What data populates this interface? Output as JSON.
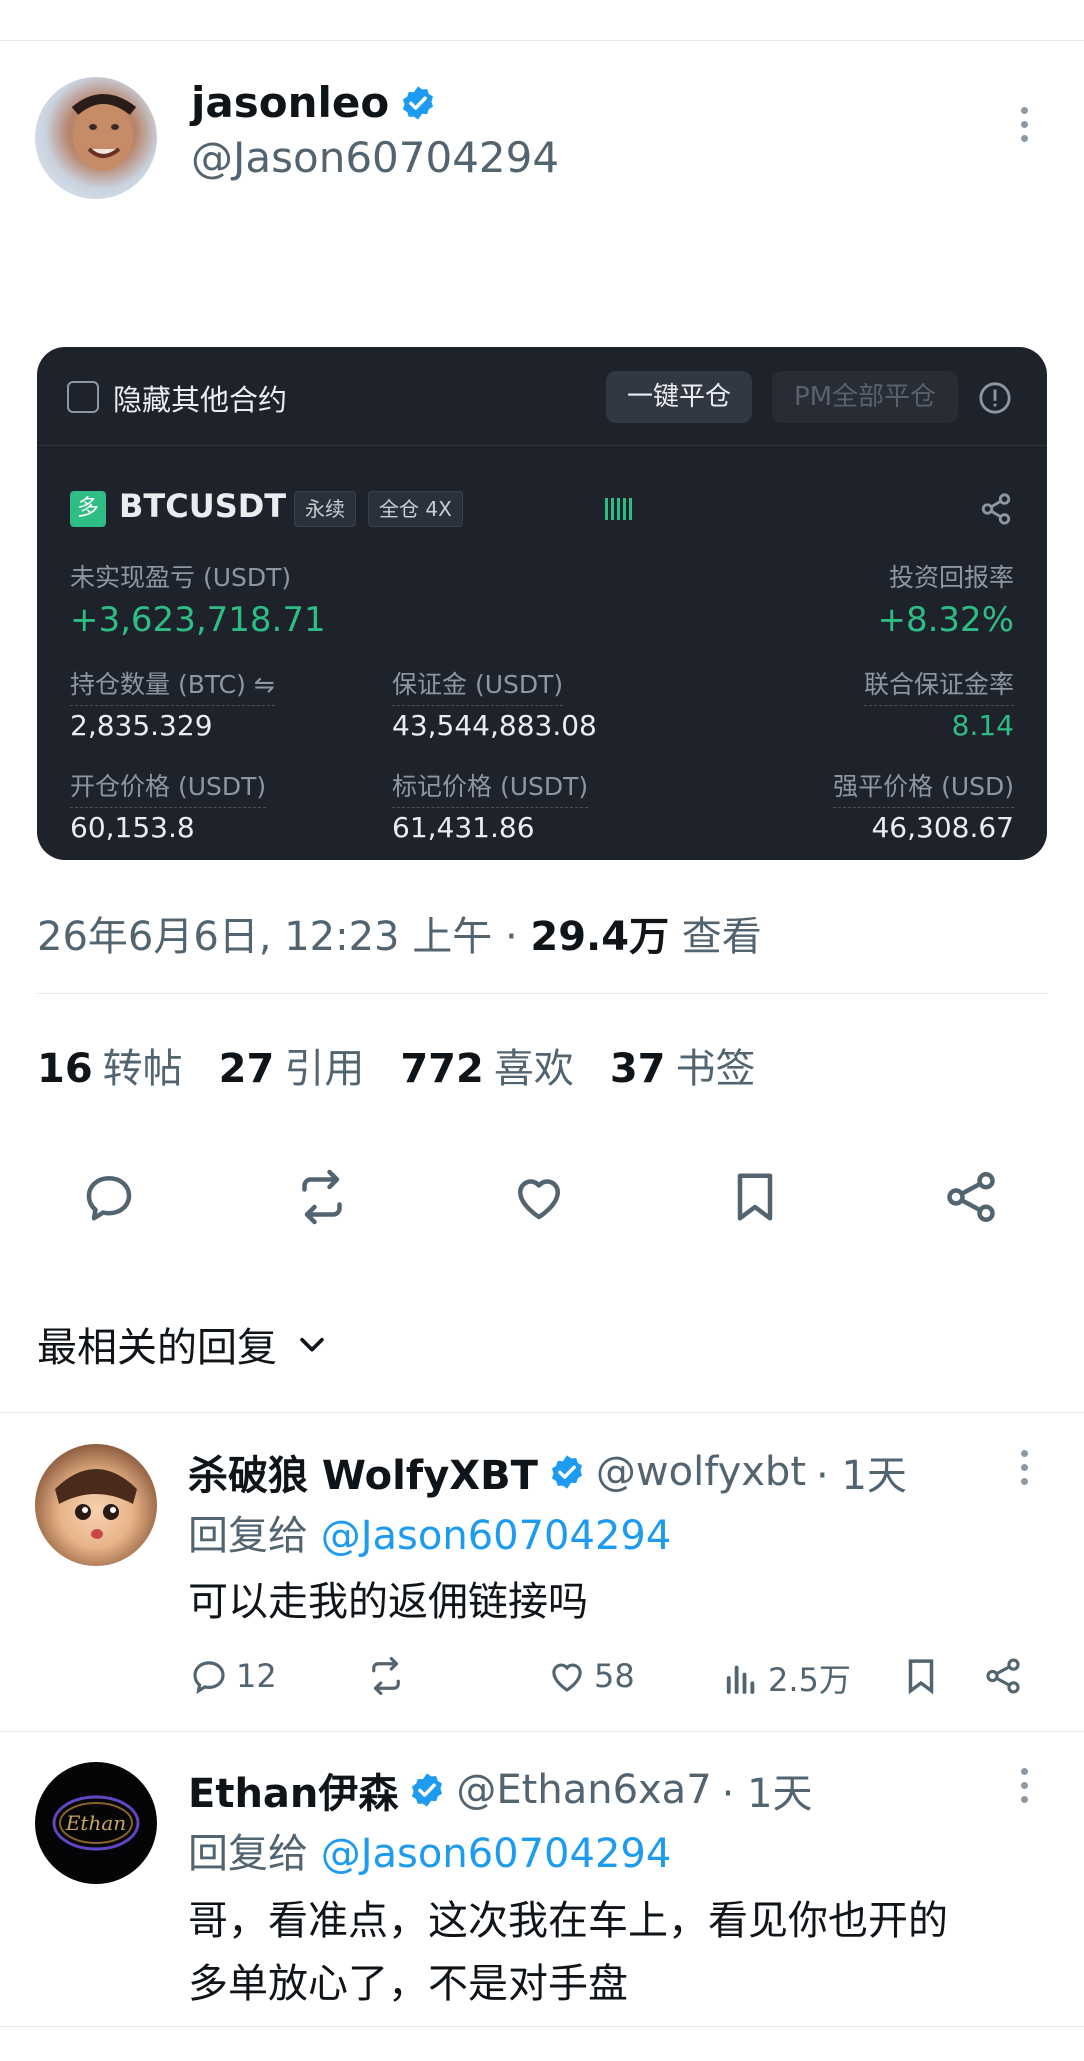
{
  "tweet": {
    "author_name": "jasonleo",
    "author_handle": "@Jason60704294",
    "timestamp": "26年6月6日, 12:23 上午",
    "separator": "·",
    "views_count": "29.4万",
    "views_label": "查看",
    "stats": [
      {
        "count": "16",
        "label": "转帖"
      },
      {
        "count": "27",
        "label": "引用"
      },
      {
        "count": "772",
        "label": "喜欢"
      },
      {
        "count": "37",
        "label": "书签"
      }
    ]
  },
  "trade_card": {
    "hide_others_label": "隐藏其他合约",
    "close_all_label": "一键平仓",
    "pm_close_label": "PM全部平仓",
    "side_badge": "多",
    "symbol": "BTCUSDT",
    "tag_perpetual": "永续",
    "tag_margin": "全仓 4X",
    "pnl_label": "未实现盈亏 (USDT)",
    "pnl_value": "+3,623,718.71",
    "roe_label": "投资回报率",
    "roe_value": "+8.32%",
    "size_label": "持仓数量 (BTC) ⇋",
    "size_value": "2,835.329",
    "margin_label": "保证金 (USDT)",
    "margin_value": "43,544,883.08",
    "margin_ratio_label": "联合保证金率",
    "margin_ratio_value": "8.14",
    "entry_label": "开仓价格 (USDT)",
    "entry_value": "60,153.8",
    "mark_label": "标记价格 (USDT)",
    "mark_value": "61,431.86",
    "liq_label": "强平价格 (USD)",
    "liq_value": "46,308.67",
    "colors": {
      "background": "#1e222b",
      "profit_green": "#2ebd85"
    }
  },
  "replies_sort": {
    "label": "最相关的回复"
  },
  "replies": [
    {
      "name": "杀破狼 WolfyXBT",
      "handle": "@wolfyxbt",
      "time": "· 1天",
      "reply_to_label": "回复给",
      "reply_to_handle": "@Jason60704294",
      "text": "可以走我的返佣链接吗",
      "comments": "12",
      "likes": "58",
      "views": "2.5万"
    },
    {
      "name": "Ethan伊森",
      "handle": "@Ethan6xa7",
      "time": "· 1天",
      "reply_to_label": "回复给",
      "reply_to_handle": "@Jason60704294",
      "text_line1": "哥，看准点，这次我在车上，看见你也开的",
      "text_line2": "多单放心了，不是对手盘",
      "avatar_text": "Ethan"
    }
  ],
  "colors": {
    "accent": "#1d9bf0",
    "secondary_text": "#536471",
    "divider": "#e6e9ec"
  }
}
